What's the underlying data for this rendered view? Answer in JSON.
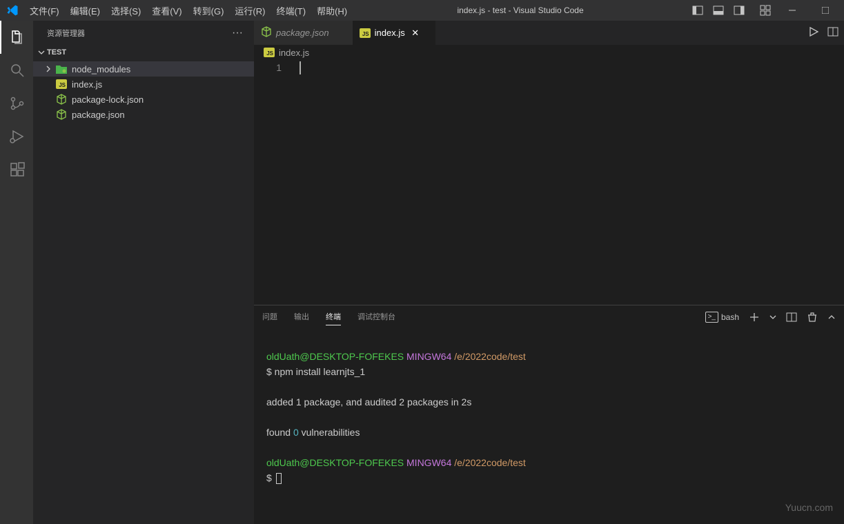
{
  "titlebar": {
    "title": "index.js - test - Visual Studio Code",
    "menu": [
      "文件(F)",
      "编辑(E)",
      "选择(S)",
      "查看(V)",
      "转到(G)",
      "运行(R)",
      "终端(T)",
      "帮助(H)"
    ]
  },
  "sidebar": {
    "header": "资源管理器",
    "project": "TEST",
    "tree": [
      {
        "name": "node_modules",
        "type": "folder",
        "expanded": false,
        "selected": true
      },
      {
        "name": "index.js",
        "type": "js"
      },
      {
        "name": "package-lock.json",
        "type": "npm"
      },
      {
        "name": "package.json",
        "type": "npm"
      }
    ]
  },
  "tabs": [
    {
      "label": "package.json",
      "icon": "npm",
      "active": false,
      "italic": true
    },
    {
      "label": "index.js",
      "icon": "js",
      "active": true,
      "italic": false
    }
  ],
  "breadcrumb": {
    "icon": "js",
    "label": "index.js"
  },
  "editor": {
    "lineNumbers": [
      "1"
    ]
  },
  "panel": {
    "tabs": [
      "问题",
      "输出",
      "终端",
      "调试控制台"
    ],
    "activeTab": 2,
    "shell": "bash"
  },
  "terminal": {
    "user": "oldUath@DESKTOP-FOFEKES",
    "env": "MINGW64",
    "path": "/e/2022code/test",
    "cmd1": "$ npm install learnjts_1",
    "out1": "added 1 package, and audited 2 packages in 2s",
    "out2a": "found ",
    "out2b": "0",
    "out2c": " vulnerabilities",
    "prompt2": "$ "
  },
  "watermark": "Yuucn.com"
}
